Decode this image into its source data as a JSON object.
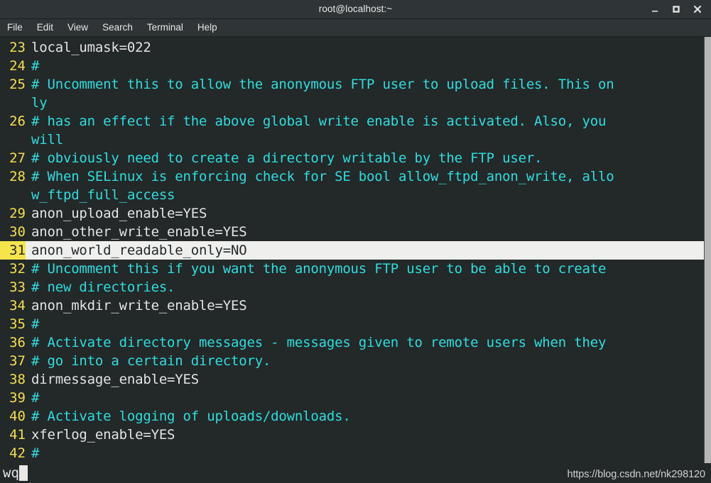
{
  "window": {
    "title": "root@localhost:~",
    "controls": [
      {
        "name": "minimize",
        "glyph": "_"
      },
      {
        "name": "maximize",
        "glyph": "□"
      },
      {
        "name": "close",
        "glyph": "✕"
      }
    ]
  },
  "menu": {
    "items": [
      "File",
      "Edit",
      "View",
      "Search",
      "Terminal",
      "Help"
    ]
  },
  "editor": {
    "current_line": 31,
    "lines": [
      {
        "num": "23",
        "text": "local_umask=022",
        "kind": "plain"
      },
      {
        "num": "24",
        "text": "#",
        "kind": "comment"
      },
      {
        "num": "25",
        "text": "# Uncomment this to allow the anonymous FTP user to upload files. This on",
        "kind": "comment"
      },
      {
        "num": "",
        "text": "ly",
        "kind": "comment",
        "cont": true
      },
      {
        "num": "26",
        "text": "# has an effect if the above global write enable is activated. Also, you",
        "kind": "comment"
      },
      {
        "num": "",
        "text": "will",
        "kind": "comment",
        "cont": true
      },
      {
        "num": "27",
        "text": "# obviously need to create a directory writable by the FTP user.",
        "kind": "comment"
      },
      {
        "num": "28",
        "text": "# When SELinux is enforcing check for SE bool allow_ftpd_anon_write, allo",
        "kind": "comment"
      },
      {
        "num": "",
        "text": "w_ftpd_full_access",
        "kind": "comment",
        "cont": true
      },
      {
        "num": "29",
        "text": "anon_upload_enable=YES",
        "kind": "plain"
      },
      {
        "num": "30",
        "text": "anon_other_write_enable=YES",
        "kind": "plain"
      },
      {
        "num": "31",
        "text": "anon_world_readable_only=NO",
        "kind": "plain",
        "current": true
      },
      {
        "num": "32",
        "text": "# Uncomment this if you want the anonymous FTP user to be able to create",
        "kind": "comment"
      },
      {
        "num": "33",
        "text": "# new directories.",
        "kind": "comment"
      },
      {
        "num": "34",
        "text": "anon_mkdir_write_enable=YES",
        "kind": "plain"
      },
      {
        "num": "35",
        "text": "#",
        "kind": "comment"
      },
      {
        "num": "36",
        "text": "# Activate directory messages - messages given to remote users when they",
        "kind": "comment"
      },
      {
        "num": "37",
        "text": "# go into a certain directory.",
        "kind": "comment"
      },
      {
        "num": "38",
        "text": "dirmessage_enable=YES",
        "kind": "plain"
      },
      {
        "num": "39",
        "text": "#",
        "kind": "comment"
      },
      {
        "num": "40",
        "text": "# Activate logging of uploads/downloads.",
        "kind": "comment"
      },
      {
        "num": "41",
        "text": "xferlog_enable=YES",
        "kind": "plain"
      },
      {
        "num": "42",
        "text": "#",
        "kind": "comment"
      }
    ]
  },
  "statusline": {
    "command": "wq"
  },
  "watermark": {
    "text": "https://blog.csdn.net/nk298120"
  },
  "colors": {
    "terminal_background": "#232829",
    "chrome_background": "#2f3436",
    "comment": "#2fdede",
    "code": "#e4e4e4",
    "line_number": "#f2e14b",
    "current_line_number_bg": "#f5e44c",
    "current_line_bg": "#efefed",
    "scrollbar": "#b6b6b6"
  }
}
